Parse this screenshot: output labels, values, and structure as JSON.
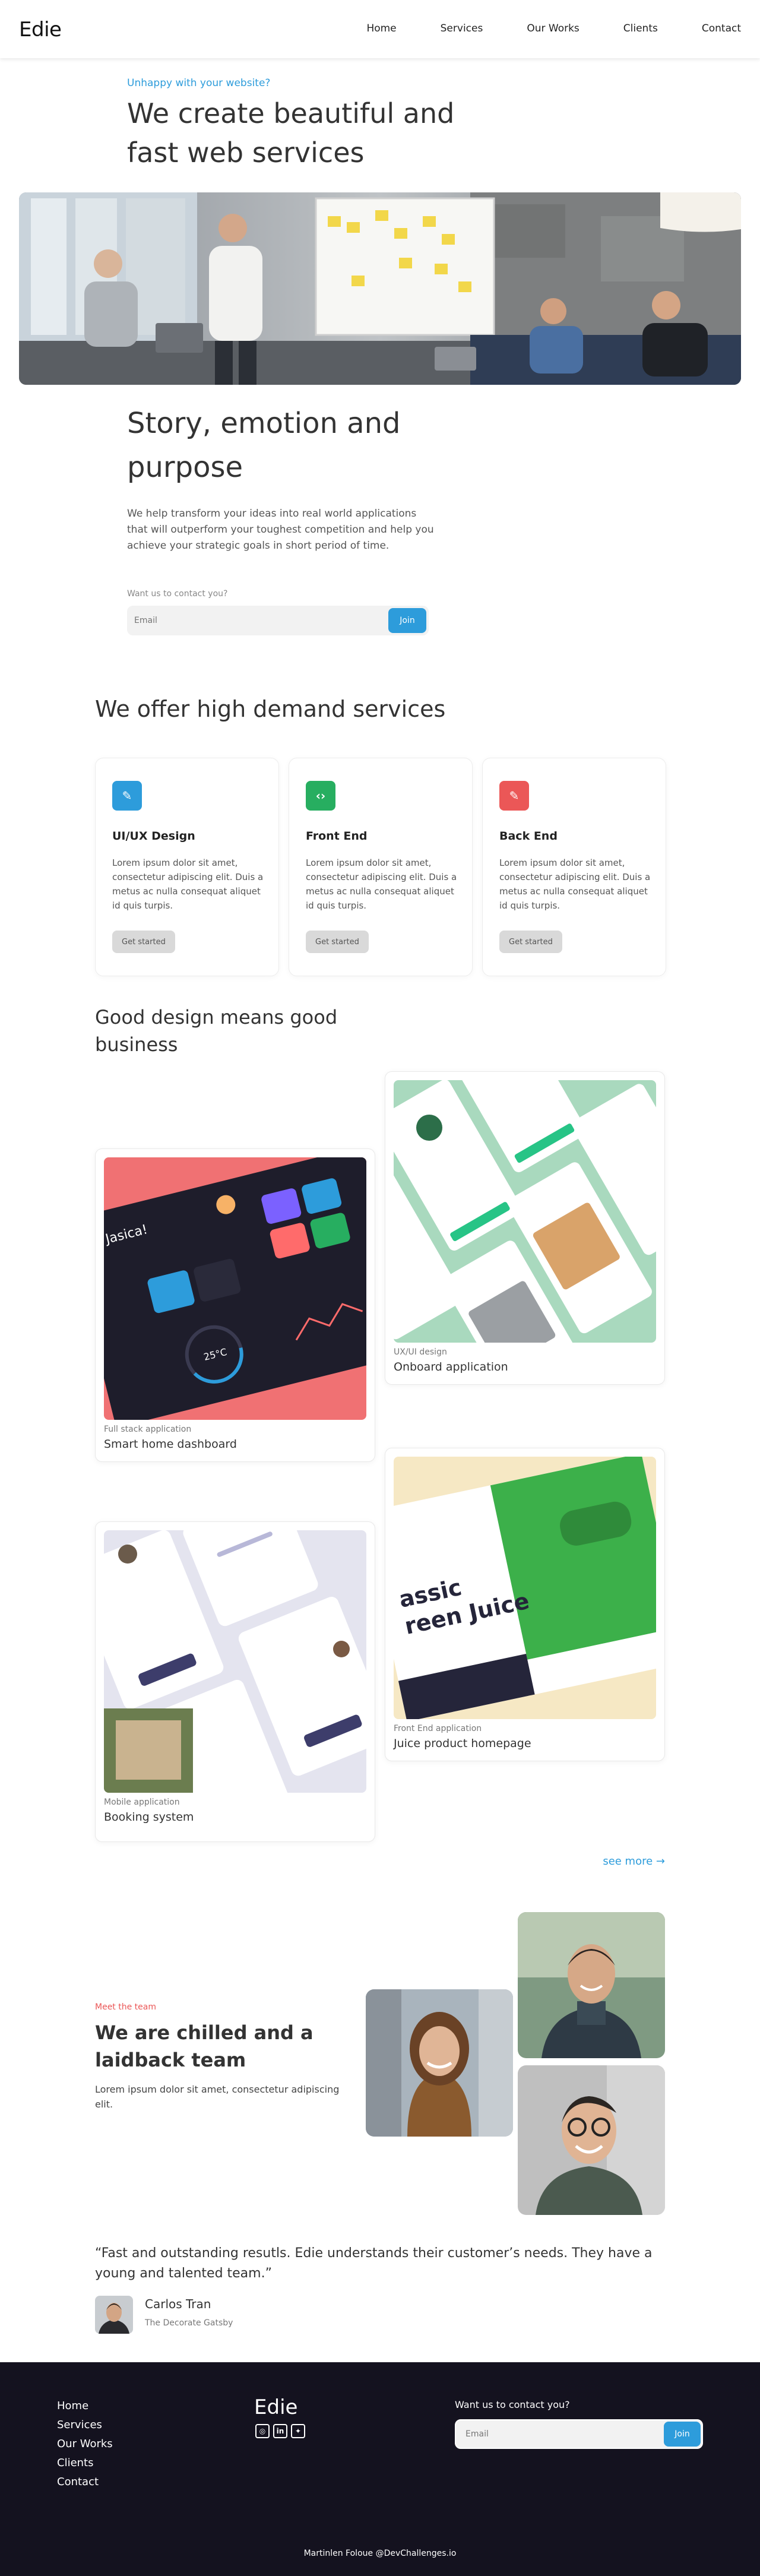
{
  "header": {
    "logo": "Edie",
    "nav": [
      "Home",
      "Services",
      "Our Works",
      "Clients",
      "Contact"
    ]
  },
  "hero": {
    "kicker": "Unhappy with your website?",
    "title": "We create beautiful and fast web services",
    "image_icon": "team-meeting-photo"
  },
  "story": {
    "title": "Story, emotion and purpose",
    "text": "We help transform your ideas into real world applications that will outperform your toughest competition and help you achieve your strategic goals in short period of time.",
    "contact_label": "Want us to contact you?",
    "email_placeholder": "Email",
    "join_label": "Join"
  },
  "services": {
    "title": "We offer high demand services",
    "items": [
      {
        "name": "UI/UX Design",
        "icon": "pencil-icon",
        "color": "#2d9cdb",
        "glyph": "✎",
        "desc": "Lorem ipsum dolor sit amet, consectetur adipiscing elit. Duis a metus ac nulla consequat aliquet id quis turpis.",
        "button": "Get started"
      },
      {
        "name": "Front End",
        "icon": "code-icon",
        "color": "#27ae60",
        "glyph": "‹›",
        "desc": "Lorem ipsum dolor sit amet, consectetur adipiscing elit. Duis a metus ac nulla consequat aliquet id quis turpis.",
        "button": "Get started"
      },
      {
        "name": "Back End",
        "icon": "pencil-icon",
        "color": "#eb5757",
        "glyph": "✎",
        "desc": "Lorem ipsum dolor sit amet, consectetur adipiscing elit. Duis a metus ac nulla consequat aliquet id quis turpis.",
        "button": "Get started"
      }
    ]
  },
  "portfolio": {
    "title": "Good design means good business",
    "works": [
      {
        "category": "UX/UI design",
        "name": "Onboard application"
      },
      {
        "category": "Full stack application",
        "name": "Smart home dashboard"
      },
      {
        "category": "Front End application",
        "name": "Juice product homepage"
      },
      {
        "category": "Mobile application",
        "name": "Booking system"
      }
    ],
    "see_more": "see more →",
    "thumb_texts": {
      "smart_home_greeting": "Hi Jasica!",
      "smart_home_temp": "25°C",
      "juice_headline_1": "assic",
      "juice_headline_2": "reen Juice"
    }
  },
  "team": {
    "kicker": "Meet the team",
    "title": "We are chilled and a laidback team",
    "text": "Lorem ipsum dolor sit amet, consectetur adipiscing elit."
  },
  "testimonial": {
    "quote": "“Fast and outstanding resutls. Edie understands their customer’s needs. They have a young and talented team.”",
    "name": "Carlos Tran",
    "company": "The Decorate Gatsby"
  },
  "footer": {
    "nav": [
      "Home",
      "Services",
      "Our Works",
      "Clients",
      "Contact"
    ],
    "logo": "Edie",
    "social": [
      "instagram-icon",
      "linkedin-icon",
      "twitter-icon"
    ],
    "contact_label": "Want us to contact you?",
    "email_placeholder": "Email",
    "join_label": "Join",
    "credit": "Martinlen Foloue @DevChallenges.io"
  },
  "colors": {
    "accent": "#2d9cdb",
    "red": "#eb5757",
    "green": "#27ae60",
    "footer_bg": "#14121f"
  }
}
